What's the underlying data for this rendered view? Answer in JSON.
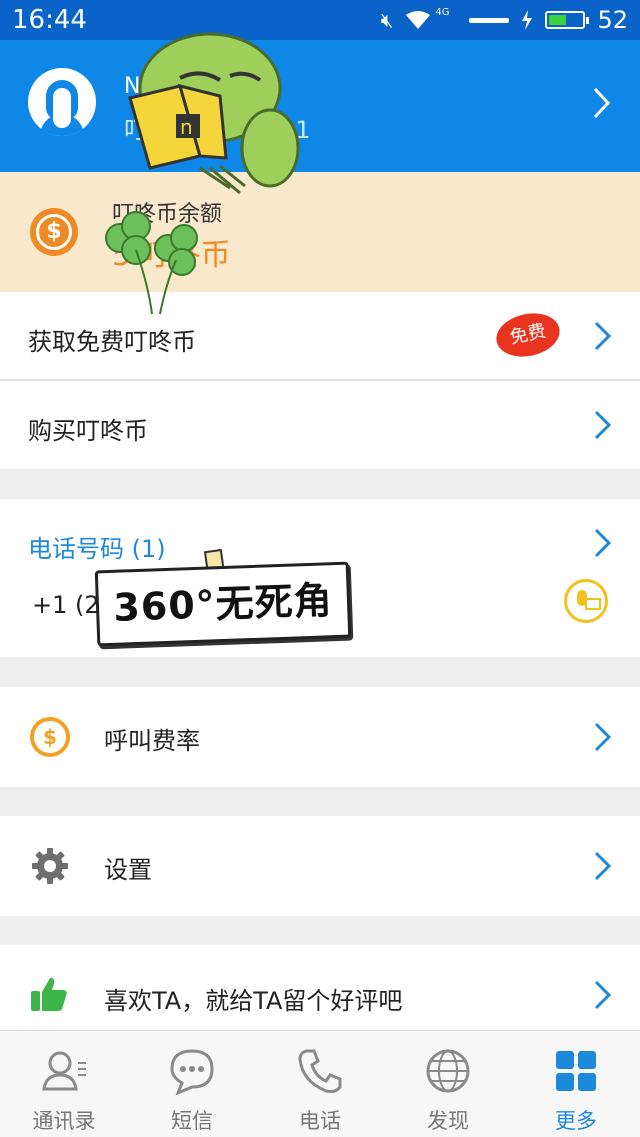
{
  "status_bar": {
    "time": "16:44",
    "network": "4G",
    "battery": "52",
    "icons": [
      "mute-icon",
      "wifi-icon",
      "signal-icon",
      "charging-icon",
      "battery-icon"
    ]
  },
  "profile": {
    "name": "N",
    "id_text": "叮",
    "id_suffix": "81"
  },
  "balance": {
    "label": "叮咚币余额",
    "value": "5 叮咚币"
  },
  "menu": {
    "free_coins": "获取免费叮咚币",
    "free_badge": "免费",
    "buy_coins": "购买叮咚币",
    "phone_title": "电话号码 (1)",
    "phone_number": "+1 (2",
    "call_rates": "呼叫费率",
    "settings": "设置",
    "review": "喜欢TA，就给TA留个好评吧"
  },
  "sticker_text": "360°无死角",
  "nav": [
    {
      "label": "通讯录",
      "icon": "contacts-icon"
    },
    {
      "label": "短信",
      "icon": "sms-icon"
    },
    {
      "label": "电话",
      "icon": "phone-icon"
    },
    {
      "label": "发现",
      "icon": "globe-icon"
    },
    {
      "label": "更多",
      "icon": "grid-icon"
    }
  ],
  "colors": {
    "header_blue": "#0e87e6",
    "accent_blue": "#1c8ad8",
    "coin_orange": "#f08a24",
    "balance_bg": "#f8e9cd",
    "badge_red": "#e8341e"
  }
}
